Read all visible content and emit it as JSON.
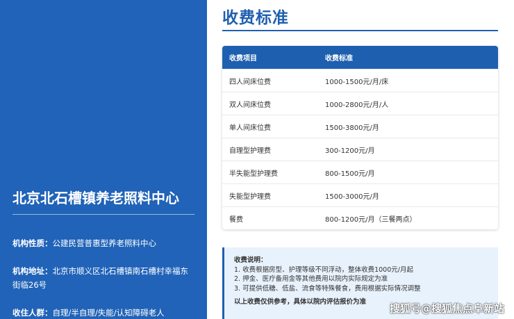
{
  "left": {
    "center_name": "北京北石槽镇养老照料中心",
    "type_label": "机构性质：",
    "type_value": "公建民营普惠型养老照料中心",
    "addr_label": "机构地址：",
    "addr_value": "北京市顺义区北石槽镇南石槽村幸福东街临26号",
    "people_label": "收住人群：",
    "people_value": "自理/半自理/失能/认知障碍老人"
  },
  "main": {
    "title": "收费标准",
    "table": {
      "headers": [
        "收费项目",
        "收费标准"
      ],
      "rows": [
        {
          "item": "四人间床位费",
          "price": "1000-1500元/月/床"
        },
        {
          "item": "双人间床位费",
          "price": "1000-2800元/月/人"
        },
        {
          "item": "单人间床位费",
          "price": "1500-3800元/月"
        },
        {
          "item": "自理型护理费",
          "price": "300-1200元/月"
        },
        {
          "item": "半失能型护理费",
          "price": "800-1500元/月"
        },
        {
          "item": "失能型护理费",
          "price": "1500-3000元/月"
        },
        {
          "item": "餐费",
          "price": "800-1200元/月（三餐两点）"
        }
      ]
    },
    "note": {
      "title": "收费说明：",
      "lines": [
        "1. 收费根据房型、护理等级不同浮动，整体收费1000元/月起",
        "2. 押金、医疗备用金等其他费用以院内实际规定为准",
        "3. 可提供低糖、低盐、流食等特殊餐食，费用根据实际情况调整"
      ],
      "final": "以上收费仅供参考，具体以院内评估报价为准"
    }
  },
  "watermark": "搜狐号@搜狐焦点阜新站"
}
